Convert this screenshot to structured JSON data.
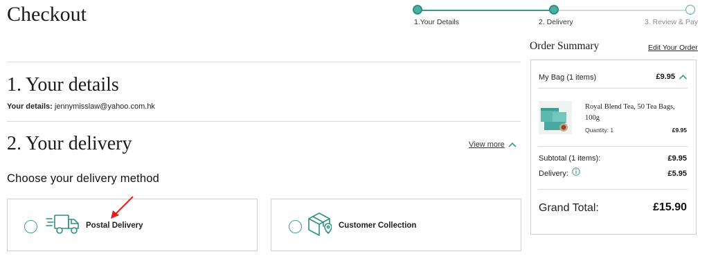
{
  "page": {
    "title": "Checkout"
  },
  "progress": {
    "steps": [
      {
        "label": "1.Your Details",
        "state": "complete"
      },
      {
        "label": "2. Delivery",
        "state": "current"
      },
      {
        "label": "3. Review & Pay",
        "state": "upcoming"
      }
    ]
  },
  "details": {
    "heading": "1. Your details",
    "label": "Your details:",
    "email": "jennymisslaw@yahoo.com.hk"
  },
  "delivery": {
    "heading": "2. Your delivery",
    "view_more": "View more",
    "method_heading": "Choose your delivery method",
    "options": [
      {
        "label": "Postal Delivery",
        "icon": "delivery-truck-icon",
        "selected": false
      },
      {
        "label": "Customer Collection",
        "icon": "box-location-pin-icon",
        "selected": false
      }
    ]
  },
  "summary": {
    "title": "Order Summary",
    "edit_link": "Edit Your Order",
    "bag_label": "My Bag (1 items)",
    "bag_total": "£9.95",
    "item": {
      "name": "Royal Blend Tea, 50 Tea Bags, 100g",
      "quantity": "Quantity: 1",
      "price": "£9.95"
    },
    "subtotal_label": "Subtotal (1 items):",
    "subtotal_value": "£9.95",
    "delivery_label": "Delivery:",
    "delivery_value": "£5.95",
    "grand_total_label": "Grand Total:",
    "grand_total_value": "£15.90"
  },
  "colors": {
    "accent": "#3a9b8c",
    "border": "#cfcfcf",
    "annotation_arrow": "#e02020"
  }
}
